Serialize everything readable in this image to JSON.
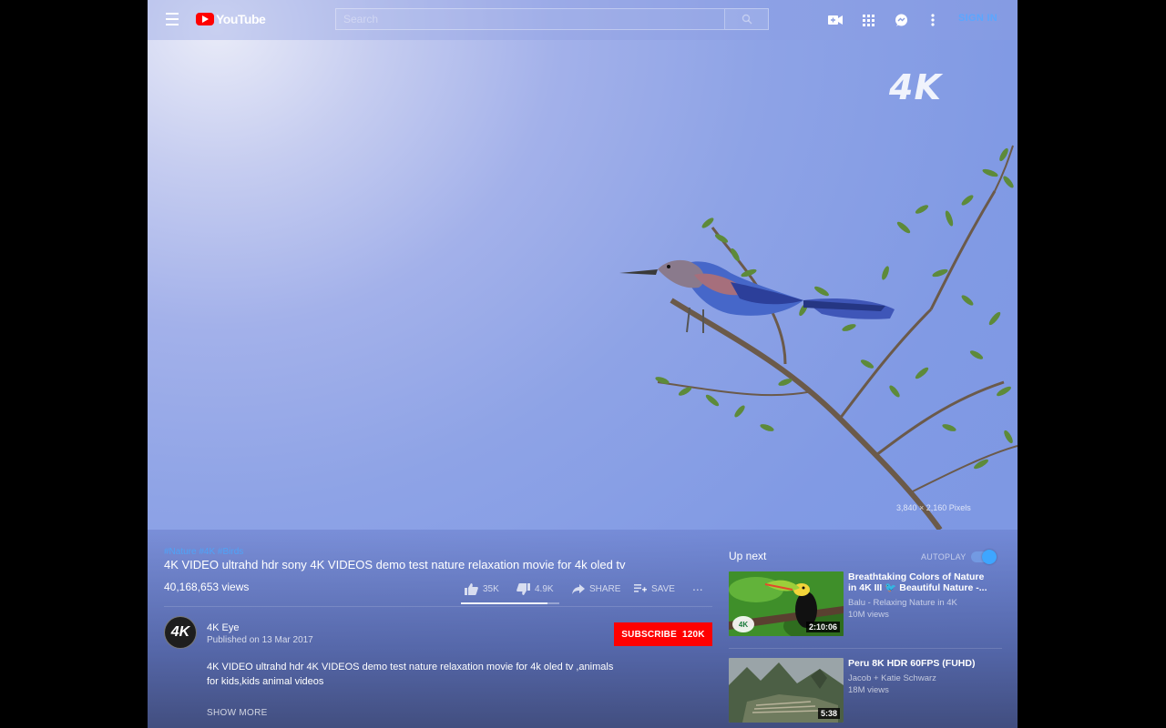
{
  "topbar": {
    "logo_text": "YouTube",
    "search_placeholder": "Search",
    "signin_label": "SIGN IN"
  },
  "video": {
    "badge": "4K",
    "resolution_note": "3,840 × 2,160 Pixels",
    "hashtags": "#Nature #4K #Birds",
    "title": "4K VIDEO ultrahd hdr sony 4K VIDEOS demo test nature relaxation movie for 4k oled tv",
    "views": "40,168,653 views",
    "actions": {
      "likes": "35K",
      "dislikes": "4.9K",
      "share": "SHARE",
      "save": "SAVE",
      "more": "..."
    },
    "like_ratio": 0.88
  },
  "channel": {
    "avatar_text": "4K",
    "name": "4K Eye",
    "published": "Published on 13 Mar 2017",
    "subscribe_label": "SUBSCRIBE",
    "subscriber_count": "120K",
    "description": "4K VIDEO ultrahd hdr 4K VIDEOS demo test nature relaxation movie for 4k oled tv ,animals for kids,kids animal videos",
    "show_more": "SHOW MORE"
  },
  "upnext": {
    "label": "Up next",
    "autoplay_label": "AUTOPLAY",
    "autoplay_on": true,
    "items": [
      {
        "title": "Breathtaking Colors of Nature in 4K III 🐦 Beautiful Nature -...",
        "channel": "Balu - Relaxing Nature in 4K",
        "views": "10M views",
        "duration": "2:10:06",
        "thumb_badge": "4K"
      },
      {
        "title": "Peru 8K HDR 60FPS (FUHD)",
        "channel": "Jacob + Katie Schwarz",
        "views": "18M views",
        "duration": "5:38"
      }
    ]
  },
  "colors": {
    "sky": "#819ae4",
    "accent_blue": "#3ea6ff",
    "subscribe_red": "#ff0000"
  }
}
